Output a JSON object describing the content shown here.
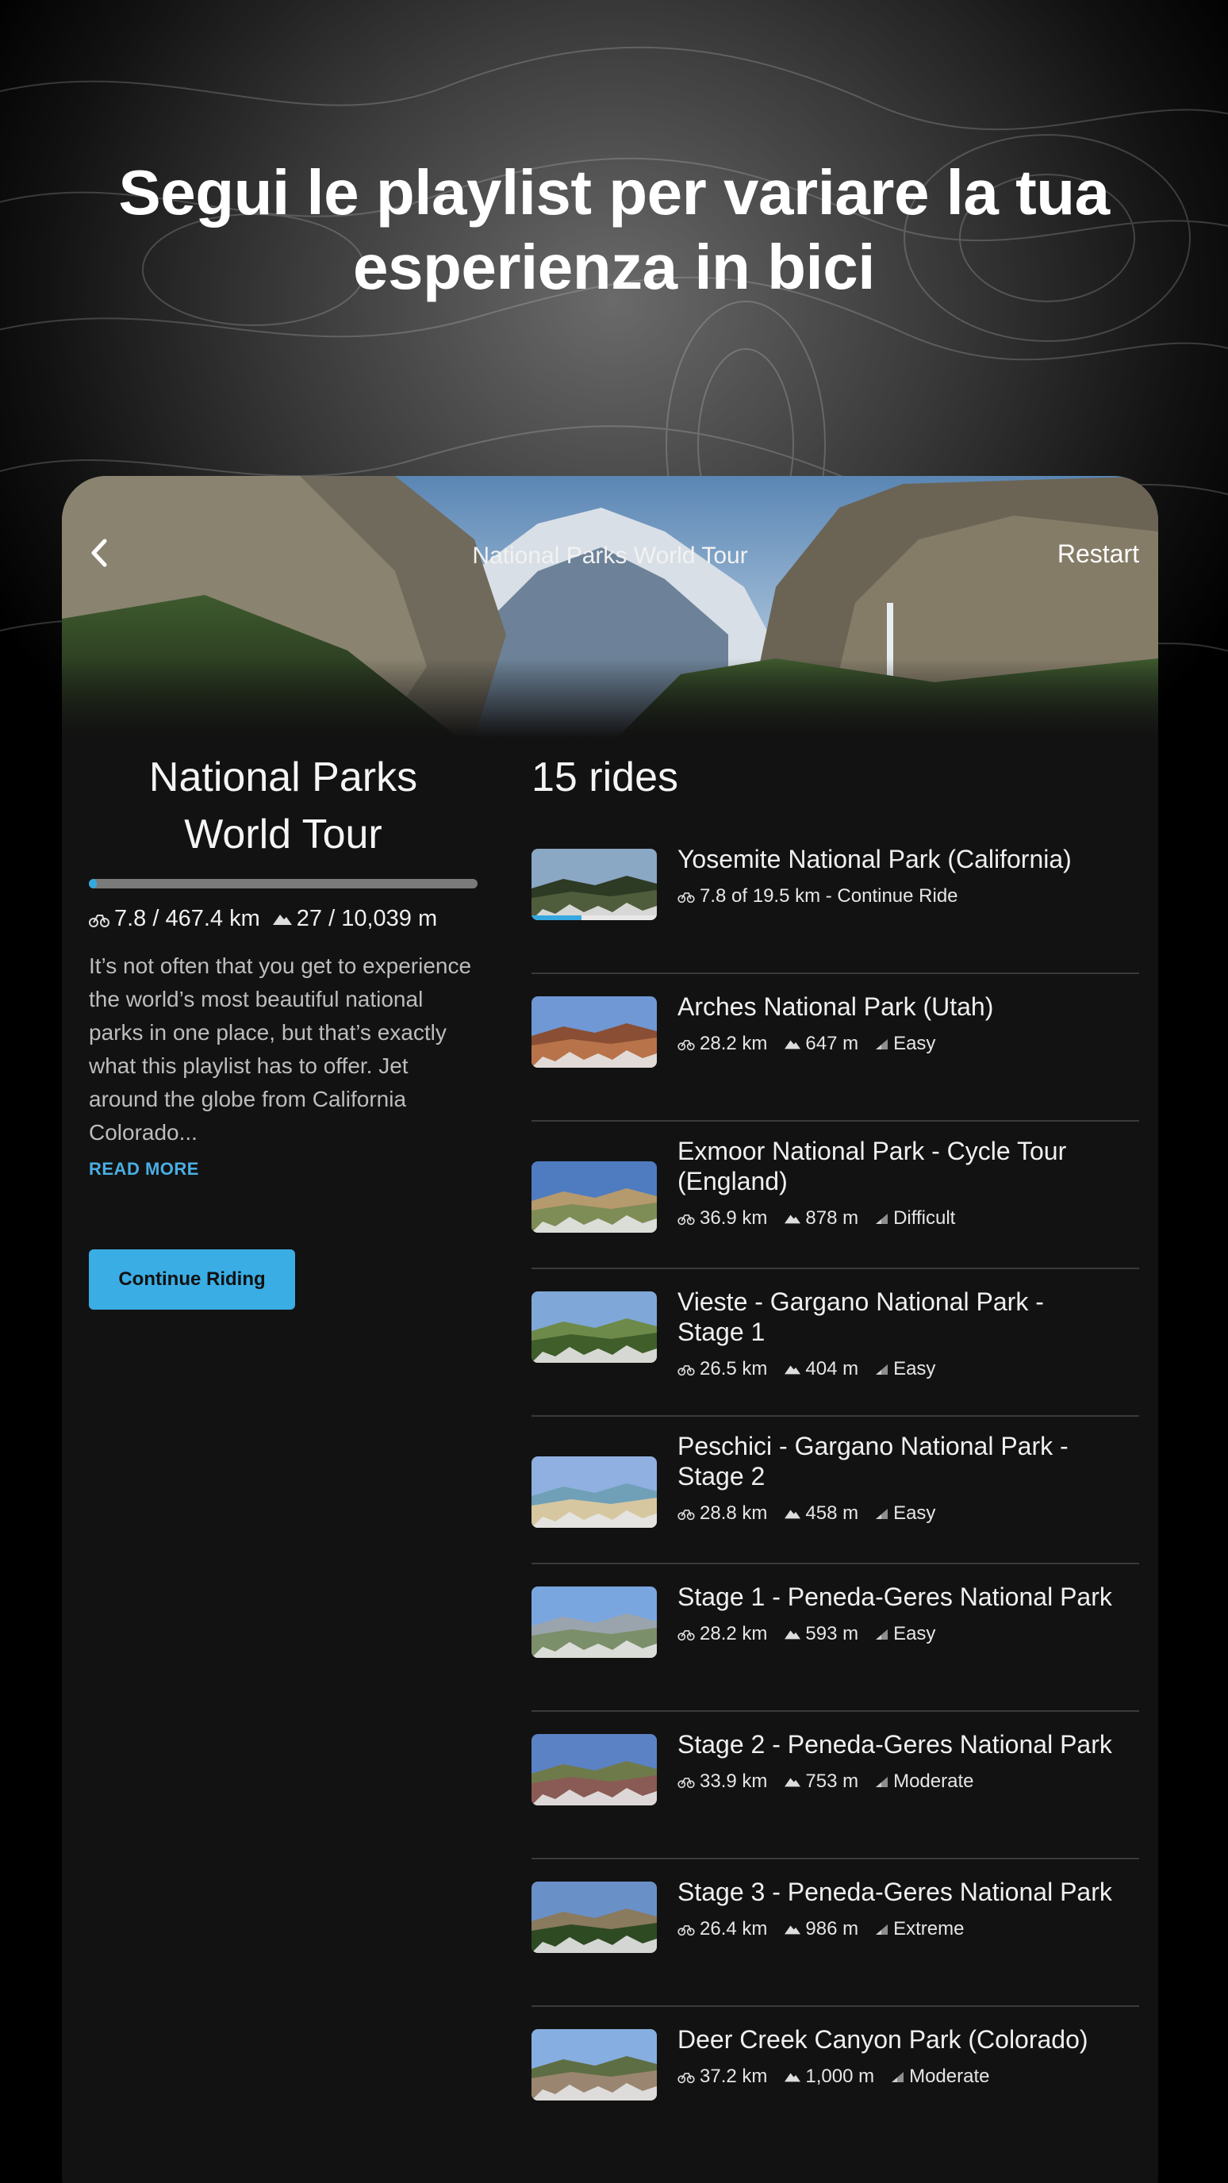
{
  "headline": {
    "line1": "Segui le playlist per variare la tua",
    "line2": "esperienza in bici"
  },
  "header": {
    "title": "National Parks World Tour",
    "restart_label": "Restart"
  },
  "playlist": {
    "title_line1": "National Parks",
    "title_line2": "World Tour",
    "progress_fraction": 0.017,
    "distance": "7.8 / 467.4 km",
    "elevation": "27 / 10,039 m",
    "description": "It’s not often that you get to experience the world’s most beautiful national parks in one place, but that’s exactly what this playlist has to offer. Jet around the globe from California Colorado...",
    "read_more": "READ MORE",
    "continue_label": "Continue Riding"
  },
  "rides": {
    "count_label": "15 rides",
    "items": [
      {
        "name": "Yosemite National Park (California)",
        "progress": "7.8 of 19.5 km - Continue Ride",
        "progress_fraction": 0.4,
        "theme": "forest"
      },
      {
        "name": "Arches National Park (Utah)",
        "distance": "28.2 km",
        "elevation": "647 m",
        "difficulty": "Easy",
        "theme": "desert"
      },
      {
        "name": "Exmoor National Park - Cycle Tour (England)",
        "distance": "36.9 km",
        "elevation": "878 m",
        "difficulty": "Difficult",
        "theme": "moor"
      },
      {
        "name": "Vieste - Gargano National Park - Stage 1",
        "distance": "26.5 km",
        "elevation": "404 m",
        "difficulty": "Easy",
        "theme": "trees"
      },
      {
        "name": "Peschici - Gargano National Park - Stage 2",
        "distance": "28.8 km",
        "elevation": "458 m",
        "difficulty": "Easy",
        "theme": "beach"
      },
      {
        "name": "Stage 1 - Peneda-Geres National Park",
        "distance": "28.2 km",
        "elevation": "593 m",
        "difficulty": "Easy",
        "theme": "bridge"
      },
      {
        "name": "Stage 2 - Peneda-Geres National Park",
        "distance": "33.9 km",
        "elevation": "753 m",
        "difficulty": "Moderate",
        "theme": "rock"
      },
      {
        "name": "Stage 3 - Peneda-Geres National Park",
        "distance": "26.4 km",
        "elevation": "986 m",
        "difficulty": "Extreme",
        "theme": "pines"
      },
      {
        "name": "Deer Creek Canyon Park (Colorado)",
        "distance": "37.2 km",
        "elevation": "1,000 m",
        "difficulty": "Moderate",
        "theme": "canyon"
      }
    ]
  },
  "colors": {
    "accent": "#3aade4",
    "background": "#121212",
    "divider": "#3a3a3a"
  },
  "icons": {
    "back": "chevron-left-icon",
    "distance": "bike-icon",
    "elevation": "mountain-icon",
    "difficulty": "signal-icon"
  }
}
